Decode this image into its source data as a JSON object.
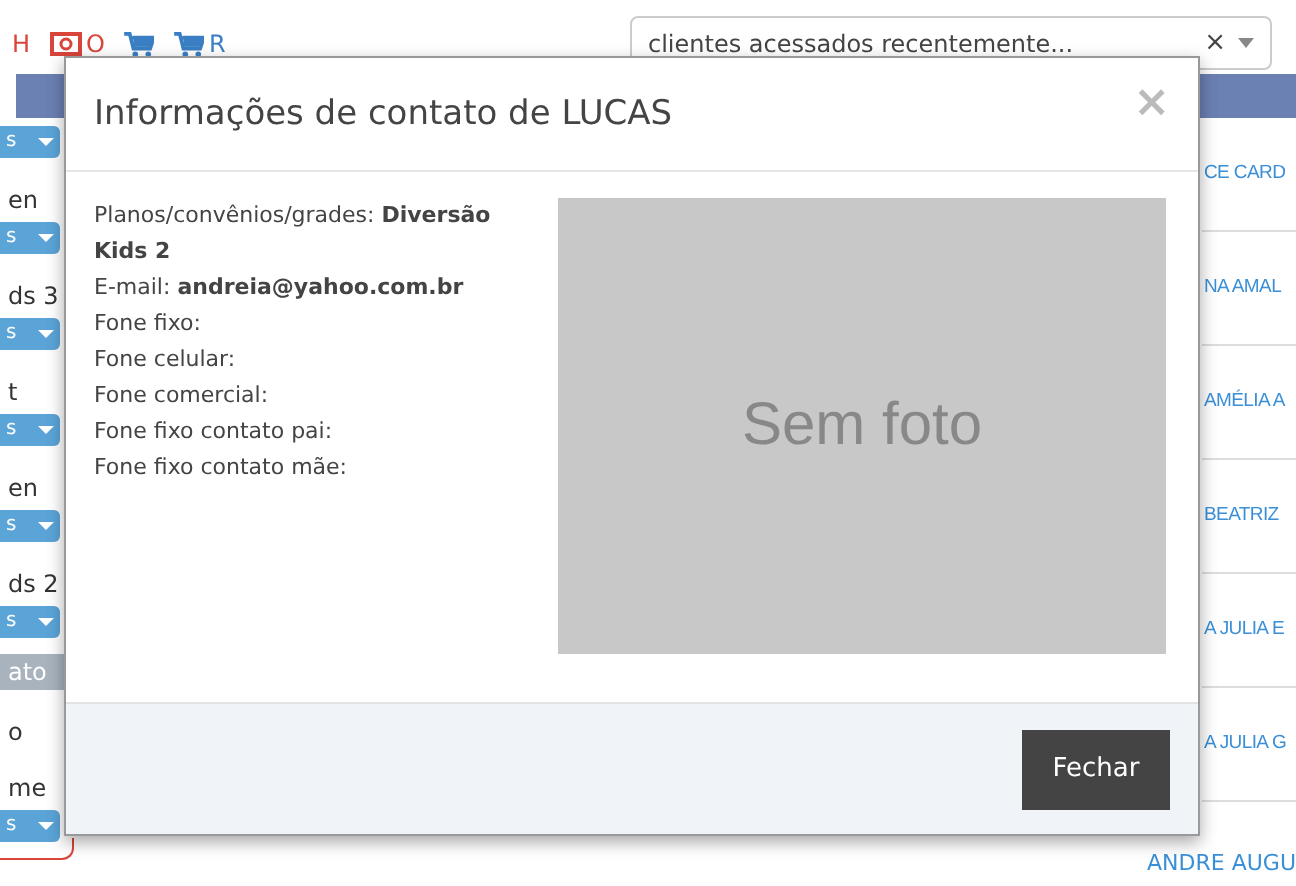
{
  "toolbar": [
    {
      "kind": "letter",
      "text": "H"
    },
    {
      "kind": "eye",
      "text": "O"
    },
    {
      "kind": "cart"
    },
    {
      "kind": "cart",
      "text": "R"
    }
  ],
  "recent_clients_select": {
    "placeholder": "clientes acessados recentemente...",
    "clear": "×"
  },
  "left_list": [
    {
      "kind": "dropdown",
      "text": "s"
    },
    {
      "kind": "label",
      "text": "en"
    },
    {
      "kind": "dropdown",
      "text": "s"
    },
    {
      "kind": "label",
      "text": "ds 3"
    },
    {
      "kind": "dropdown",
      "text": "s"
    },
    {
      "kind": "label",
      "text": "t"
    },
    {
      "kind": "dropdown",
      "text": "s"
    },
    {
      "kind": "label",
      "text": "en"
    },
    {
      "kind": "dropdown",
      "text": "s"
    },
    {
      "kind": "label",
      "text": "ds 2"
    },
    {
      "kind": "dropdown",
      "text": "s"
    },
    {
      "kind": "band",
      "text": "ato"
    },
    {
      "kind": "label",
      "text": "o"
    },
    {
      "kind": "label",
      "text": "me"
    },
    {
      "kind": "dropdown",
      "text": "s"
    }
  ],
  "right_list": [
    "CE CARD",
    "NA AMAL",
    "AMÉLIA A",
    "BEATRIZ",
    "A JULIA E",
    "A JULIA G"
  ],
  "bottom_link": "ANDRE AUGU",
  "modal": {
    "title": "Informações de contato de LUCAS",
    "close": "×",
    "fields": [
      "Planos/convênios/grades: **Diversão Kids 2**",
      "E-mail: **andreia@yahoo.com.br**",
      "Fone fixo:",
      "Fone celular:",
      "Fone comercial:",
      "Fone fixo contato pai:",
      "Fone fixo contato mãe:"
    ],
    "photo_text": "Sem foto",
    "button": "Fechar"
  }
}
